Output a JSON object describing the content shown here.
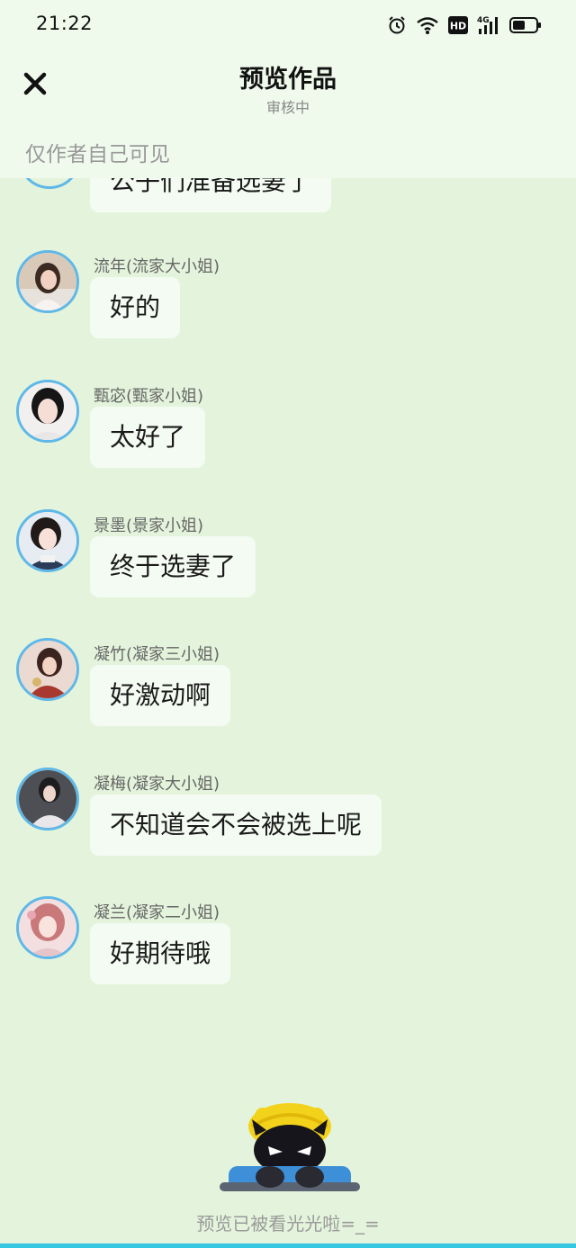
{
  "status_bar": {
    "time": "21:22",
    "icons": [
      "alarm-icon",
      "wifi-icon",
      "hd-icon",
      "signal-4g-icon",
      "battery-icon"
    ],
    "hd_label": "HD",
    "network_label": "4G"
  },
  "header": {
    "title": "预览作品",
    "subtitle": "审核中",
    "close_icon": "close-icon"
  },
  "visibility_note": "仅作者自己可见",
  "partial_message": "公子们准备选妻了",
  "messages": [
    {
      "sender": "流年(流家大小姐)",
      "text": "好的"
    },
    {
      "sender": "甄宓(甄家小姐)",
      "text": "太好了"
    },
    {
      "sender": "景墨(景家小姐)",
      "text": "终于选妻了"
    },
    {
      "sender": "凝竹(凝家三小姐)",
      "text": "好激动啊"
    },
    {
      "sender": "凝梅(凝家大小姐)",
      "text": "不知道会不会被选上呢"
    },
    {
      "sender": "凝兰(凝家二小姐)",
      "text": "好期待哦"
    }
  ],
  "footer": {
    "text": "预览已被看光光啦=_="
  },
  "colors": {
    "background": "#e4f4dc",
    "header_background": "#effaec",
    "avatar_border": "#5fb8e8",
    "bubble": "#f4fbf2",
    "bottom_strip": "#36c6e2"
  }
}
